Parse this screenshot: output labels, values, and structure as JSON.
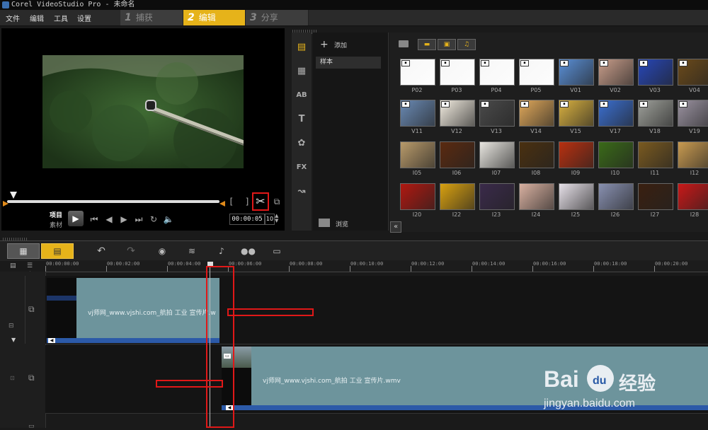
{
  "window": {
    "title": "Corel VideoStudio Pro - 未命名"
  },
  "menu": [
    "文件",
    "编辑",
    "工具",
    "设置"
  ],
  "steps": [
    {
      "num": "1",
      "label": "捕获"
    },
    {
      "num": "2",
      "label": "编辑"
    },
    {
      "num": "3",
      "label": "分享"
    }
  ],
  "preview": {
    "mode_project": "项目",
    "mode_clip": "素材",
    "timecode": "00:00:05",
    "timecode_frame": "10",
    "trim_in": "[",
    "trim_out": "]"
  },
  "library": {
    "add_label": "添加",
    "folder_sample": "样本",
    "browse_label": "浏览",
    "collapse_icon": "«",
    "side_icons": [
      "media-icon",
      "transition-icon",
      "title-ab-icon",
      "text-icon",
      "graphics-icon",
      "fx-icon",
      "path-icon"
    ],
    "side_glyphs": [
      "▤",
      "▦",
      "AB",
      "T",
      "✿",
      "FX",
      "↝"
    ],
    "thumbnails": [
      [
        "P02",
        "P03",
        "P04",
        "P05",
        "V01",
        "V02",
        "V03",
        "V04"
      ],
      [
        "V11",
        "V12",
        "V13",
        "V14",
        "V15",
        "V17",
        "V18",
        "V19"
      ],
      [
        "I05",
        "I06",
        "I07",
        "I08",
        "I09",
        "I10",
        "I11",
        "I12"
      ],
      [
        "I20",
        "I22",
        "I23",
        "I24",
        "I25",
        "I26",
        "I27",
        "I28"
      ]
    ]
  },
  "timeline": {
    "ticks": [
      "00:00:00:00",
      "00:00:02:00",
      "00:00:04:00",
      "00:00:06:00",
      "00:00:08:00",
      "00:00:10:00",
      "00:00:12:00",
      "00:00:14:00",
      "00:00:16:00",
      "00:00:18:00",
      "00:00:20:00"
    ],
    "clip1_label": "vj师网_www.vjshi.com_航拍 工业 宣传片.w",
    "clip2_label": "vj师网_www.vjshi.com_航拍 工业 宣传片.wmv",
    "zoom_label": "+/-"
  },
  "watermark": {
    "brand": "Bai",
    "brand2": "du",
    "cn": "经验",
    "url": "jingyan.baidu.com"
  },
  "colors": {
    "accent": "#e6b31a",
    "clip": "#6d949c",
    "highlight": "#e01818",
    "audio_bar": "#2c5aa8"
  }
}
